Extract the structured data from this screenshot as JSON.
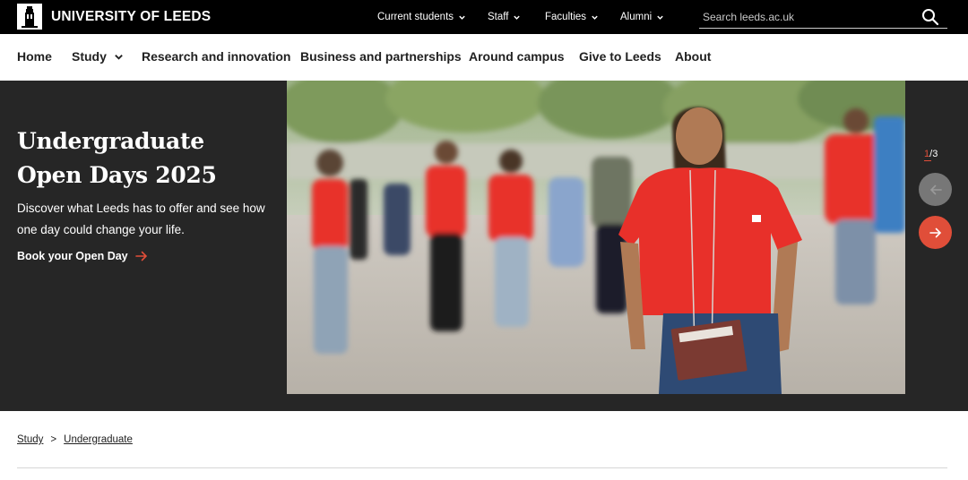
{
  "brand": {
    "name": "UNIVERSITY OF LEEDS"
  },
  "topnav": {
    "items": [
      {
        "label": "Current students"
      },
      {
        "label": "Staff"
      },
      {
        "label": "Faculties"
      },
      {
        "label": "Alumni"
      }
    ]
  },
  "search": {
    "placeholder": "Search leeds.ac.uk",
    "icon": "search-icon"
  },
  "mainnav": {
    "items": [
      {
        "label": "Home"
      },
      {
        "label": "Study"
      },
      {
        "label": "Research and innovation"
      },
      {
        "label": "Business and partnerships"
      },
      {
        "label": "Around campus"
      },
      {
        "label": "Give to Leeds"
      },
      {
        "label": "About"
      }
    ]
  },
  "hero": {
    "title_line1": "Undergraduate",
    "title_line2": "Open Days 2025",
    "description": "Discover what Leeds has to offer and see how one day could change your life.",
    "cta_label": "Book your Open Day",
    "slide_current": "1",
    "slide_sep": "/",
    "slide_total": "3"
  },
  "breadcrumb": {
    "items": [
      {
        "label": "Study"
      },
      {
        "label": "Undergraduate"
      }
    ],
    "separator": ">"
  },
  "colors": {
    "accent": "#e04e39",
    "topbar": "#000000",
    "hero_bg": "#262626",
    "shirt_red": "#e8302a"
  }
}
